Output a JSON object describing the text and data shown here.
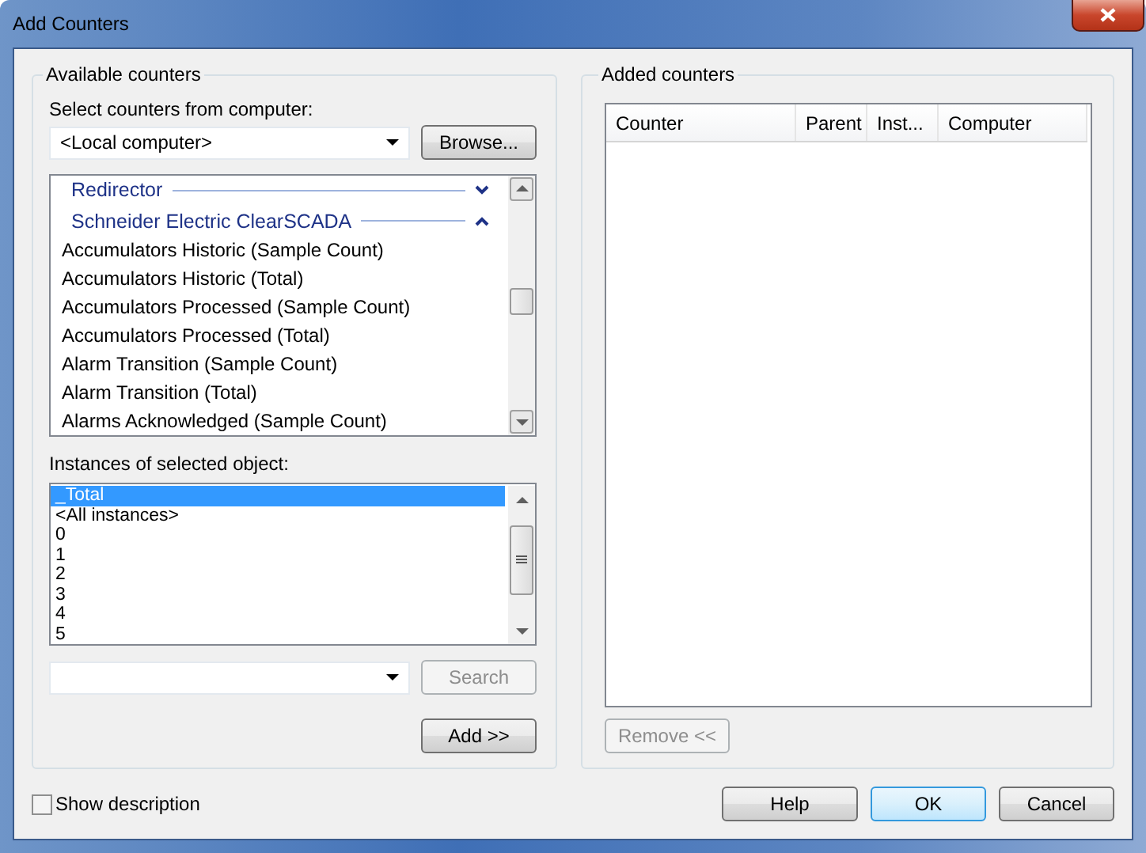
{
  "window": {
    "title": "Add Counters"
  },
  "available": {
    "title": "Available counters",
    "computer_label": "Select counters from computer:",
    "computer": "<Local computer>",
    "browse_button": "Browse...",
    "categories": [
      {
        "name": "Redirector",
        "expanded": false
      },
      {
        "name": "Schneider Electric ClearSCADA",
        "expanded": true,
        "children": [
          {
            "name": "Accumulators Historic (Sample Count)"
          },
          {
            "name": "Accumulators Historic (Total)"
          },
          {
            "name": "Accumulators Processed (Sample Count)"
          },
          {
            "name": "Accumulators Processed (Total)"
          },
          {
            "name": "Alarm Transition (Sample Count)"
          },
          {
            "name": "Alarm Transition (Total)"
          },
          {
            "name": "Alarms Acknowledged (Sample Count)"
          }
        ]
      }
    ],
    "instances_label": "Instances of selected object:",
    "instances": [
      {
        "label": "_Total",
        "selected": true
      },
      {
        "label": "<All instances>",
        "selected": false
      },
      {
        "label": "0",
        "selected": false
      },
      {
        "label": "1",
        "selected": false
      },
      {
        "label": "2",
        "selected": false
      },
      {
        "label": "3",
        "selected": false
      },
      {
        "label": "4",
        "selected": false
      },
      {
        "label": "5",
        "selected": false
      }
    ],
    "search_button": {
      "label": "Search",
      "disabled": true
    },
    "add_button": {
      "label": "Add >>",
      "disabled": false
    }
  },
  "added": {
    "title": "Added counters",
    "columns": [
      "Counter",
      "Parent",
      "Inst...",
      "Computer"
    ],
    "remove_button": {
      "label": "Remove <<",
      "disabled": true
    }
  },
  "show_description": {
    "label": "Show description",
    "checked": false
  },
  "buttons": [
    {
      "label": "Help",
      "default": false
    },
    {
      "label": "OK",
      "default": true
    },
    {
      "label": "Cancel",
      "default": false
    }
  ]
}
